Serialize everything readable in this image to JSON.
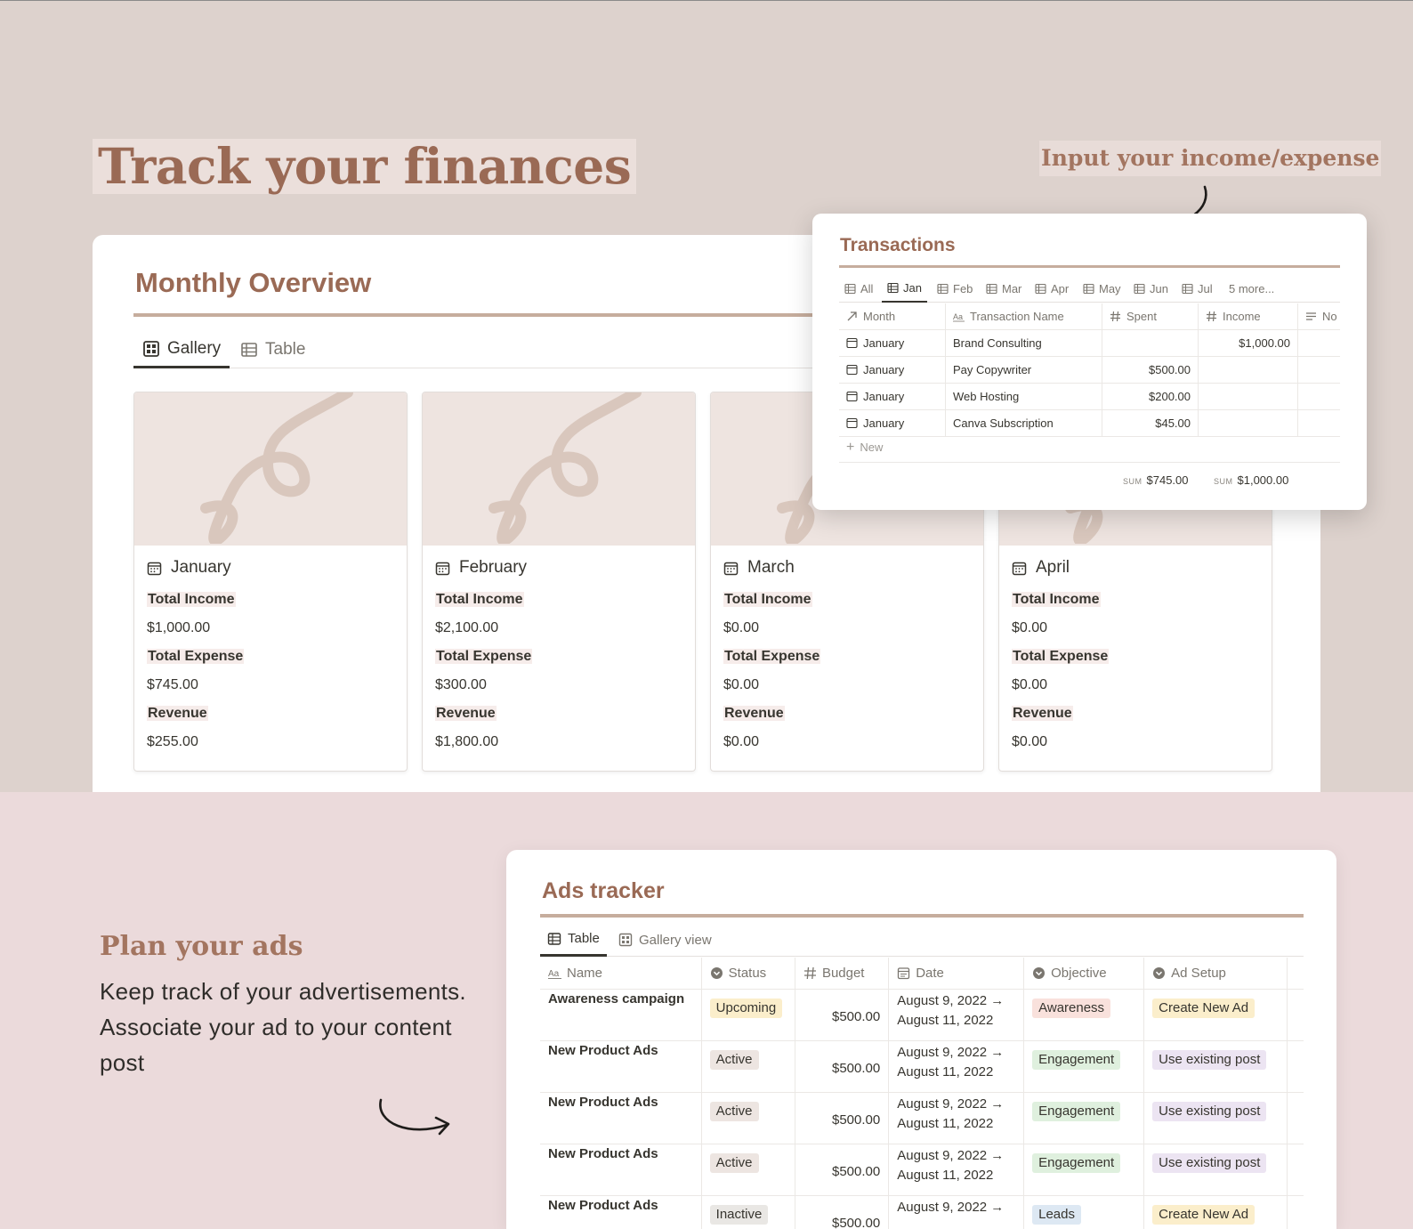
{
  "hero": {
    "title": "Track your finances",
    "callout": "Input your income/expense"
  },
  "overview": {
    "title": "Monthly Overview",
    "tabs": [
      {
        "label": "Gallery",
        "icon": "gallery-icon",
        "active": true
      },
      {
        "label": "Table",
        "icon": "table-icon",
        "active": false
      }
    ],
    "labels": {
      "income": "Total Income",
      "expense": "Total Expense",
      "revenue": "Revenue"
    },
    "cards": [
      {
        "month": "January",
        "income": "$1,000.00",
        "expense": "$745.00",
        "revenue": "$255.00"
      },
      {
        "month": "February",
        "income": "$2,100.00",
        "expense": "$300.00",
        "revenue": "$1,800.00"
      },
      {
        "month": "March",
        "income": "$0.00",
        "expense": "$0.00",
        "revenue": "$0.00"
      },
      {
        "month": "April",
        "income": "$0.00",
        "expense": "$0.00",
        "revenue": "$0.00"
      }
    ]
  },
  "transactions": {
    "title": "Transactions",
    "tabs": [
      "All",
      "Jan",
      "Feb",
      "Mar",
      "Apr",
      "May",
      "Jun",
      "Jul"
    ],
    "active_tab": "Jan",
    "more_label": "5 more...",
    "columns": [
      "Month",
      "Transaction Name",
      "Spent",
      "Income",
      "No"
    ],
    "rows": [
      {
        "month": "January",
        "name": "Brand Consulting",
        "spent": "",
        "income": "$1,000.00"
      },
      {
        "month": "January",
        "name": "Pay Copywriter",
        "spent": "$500.00",
        "income": ""
      },
      {
        "month": "January",
        "name": "Web Hosting",
        "spent": "$200.00",
        "income": ""
      },
      {
        "month": "January",
        "name": "Canva Subscription",
        "spent": "$45.00",
        "income": ""
      }
    ],
    "new_label": "New",
    "sum_label": "SUM",
    "sum_spent": "$745.00",
    "sum_income": "$1,000.00"
  },
  "plan": {
    "title": "Plan your ads",
    "description": "Keep track of your advertisements. Associate your ad to your content post"
  },
  "ads": {
    "title": "Ads tracker",
    "tabs": [
      {
        "label": "Table",
        "icon": "table-icon",
        "active": true
      },
      {
        "label": "Gallery view",
        "icon": "gallery-icon",
        "active": false
      }
    ],
    "columns": [
      "Name",
      "Status",
      "Budget",
      "Date",
      "Objective",
      "Ad Setup"
    ],
    "rows": [
      {
        "name": "Awareness campaign",
        "status": "Upcoming",
        "budget": "$500.00",
        "date_start": "August 9, 2022 →",
        "date_end": "August 11, 2022",
        "objective": "Awareness",
        "setup": "Create New Ad"
      },
      {
        "name": "New Product Ads",
        "status": "Active",
        "budget": "$500.00",
        "date_start": "August 9, 2022 →",
        "date_end": "August 11, 2022",
        "objective": "Engagement",
        "setup": "Use existing post"
      },
      {
        "name": "New Product Ads",
        "status": "Active",
        "budget": "$500.00",
        "date_start": "August 9, 2022 →",
        "date_end": "August 11, 2022",
        "objective": "Engagement",
        "setup": "Use existing post"
      },
      {
        "name": "New Product Ads",
        "status": "Active",
        "budget": "$500.00",
        "date_start": "August 9, 2022 →",
        "date_end": "August 11, 2022",
        "objective": "Engagement",
        "setup": "Use existing post"
      },
      {
        "name": "New Product Ads",
        "status": "Inactive",
        "budget": "$500.00",
        "date_start": "August 9, 2022 →",
        "date_end": "",
        "objective": "Leads",
        "setup": "Create New Ad"
      }
    ],
    "pill_colors": {
      "Upcoming": {
        "bg": "#fbeecb",
        "fg": "#37352f"
      },
      "Active": {
        "bg": "#ede5e1",
        "fg": "#37352f"
      },
      "Inactive": {
        "bg": "#e9e7e4",
        "fg": "#37352f"
      },
      "Awareness": {
        "bg": "#f9e1dc",
        "fg": "#37352f"
      },
      "Engagement": {
        "bg": "#dff0de",
        "fg": "#37352f"
      },
      "Leads": {
        "bg": "#dde8f3",
        "fg": "#37352f"
      },
      "Create New Ad": {
        "bg": "#fbeecb",
        "fg": "#37352f"
      },
      "Use existing post": {
        "bg": "#ece4f2",
        "fg": "#37352f"
      }
    }
  }
}
